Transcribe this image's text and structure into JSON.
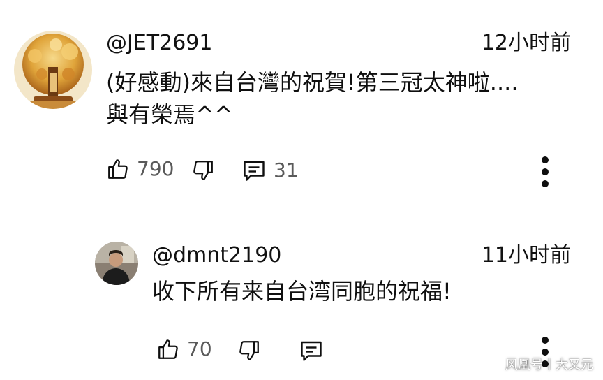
{
  "comments": [
    {
      "username": "@JET2691",
      "timestamp": "12小时前",
      "text_line1": "(好感動)來自台灣的祝賀!第三冠太神啦....",
      "text_line2": "與有榮焉^^",
      "like_count": "790",
      "reply_count": "31",
      "avatar_icon": "golden-tree-avatar"
    },
    {
      "username": "@dmnt2190",
      "timestamp": "11小时前",
      "text_line1": "收下所有来自台湾同胞的祝福!",
      "like_count": "70",
      "avatar_icon": "person-photo-avatar"
    }
  ],
  "watermark": "风凰号丨大又元",
  "colors": {
    "text": "#0f0f0f",
    "secondary_text": "#5a5a5a",
    "icon": "#0f0f0f",
    "background": "#ffffff"
  }
}
